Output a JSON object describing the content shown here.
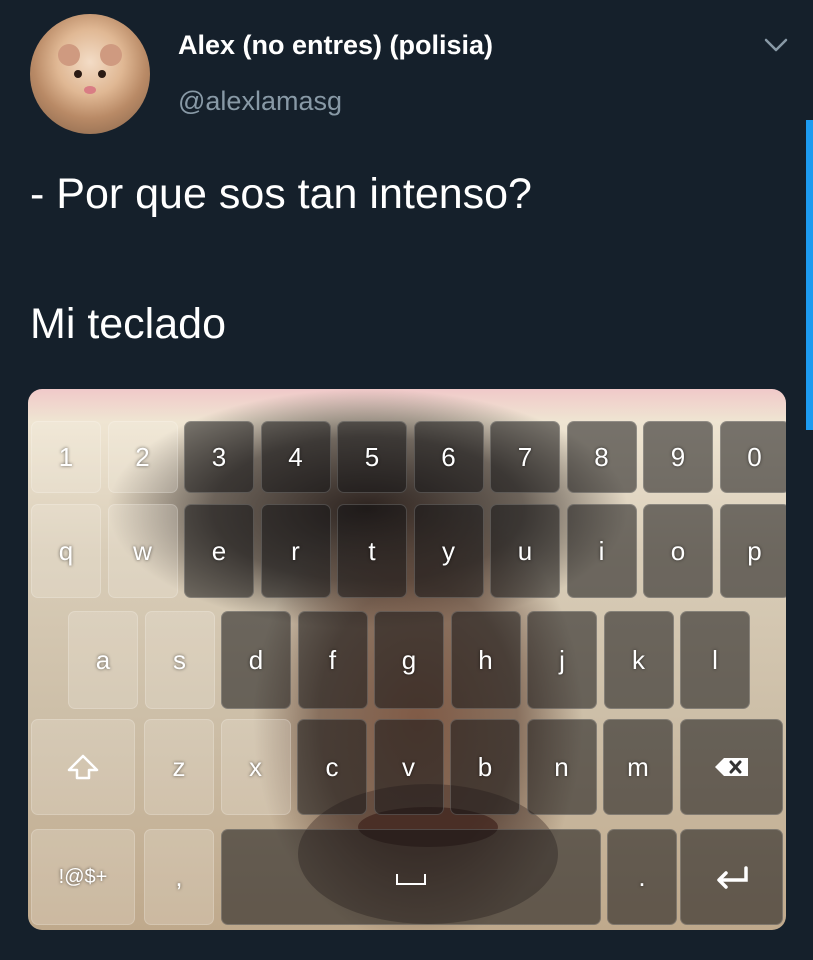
{
  "tweet": {
    "display_name": "Alex (no entres) (polisia)",
    "handle": "@alexlamasg",
    "text_line_1": "- Por que sos tan intenso?",
    "text_line_2": "Mi teclado"
  },
  "keyboard": {
    "row1": [
      "1",
      "2",
      "3",
      "4",
      "5",
      "6",
      "7",
      "8",
      "9",
      "0"
    ],
    "row2": [
      "q",
      "w",
      "e",
      "r",
      "t",
      "y",
      "u",
      "i",
      "o",
      "p"
    ],
    "row3": [
      "a",
      "s",
      "d",
      "f",
      "g",
      "h",
      "j",
      "k",
      "l"
    ],
    "row4": [
      "z",
      "x",
      "c",
      "v",
      "b",
      "n",
      "m"
    ],
    "symbols_key": "!@$+",
    "comma_key": ",",
    "period_key": ".",
    "shift_icon": "shift-arrow-icon",
    "backspace_icon": "backspace-icon",
    "enter_icon": "enter-icon",
    "space_icon": "spacebar-icon"
  },
  "colors": {
    "background": "#15202b",
    "secondary_text": "#8899a6",
    "accent": "#1d9bf0"
  }
}
